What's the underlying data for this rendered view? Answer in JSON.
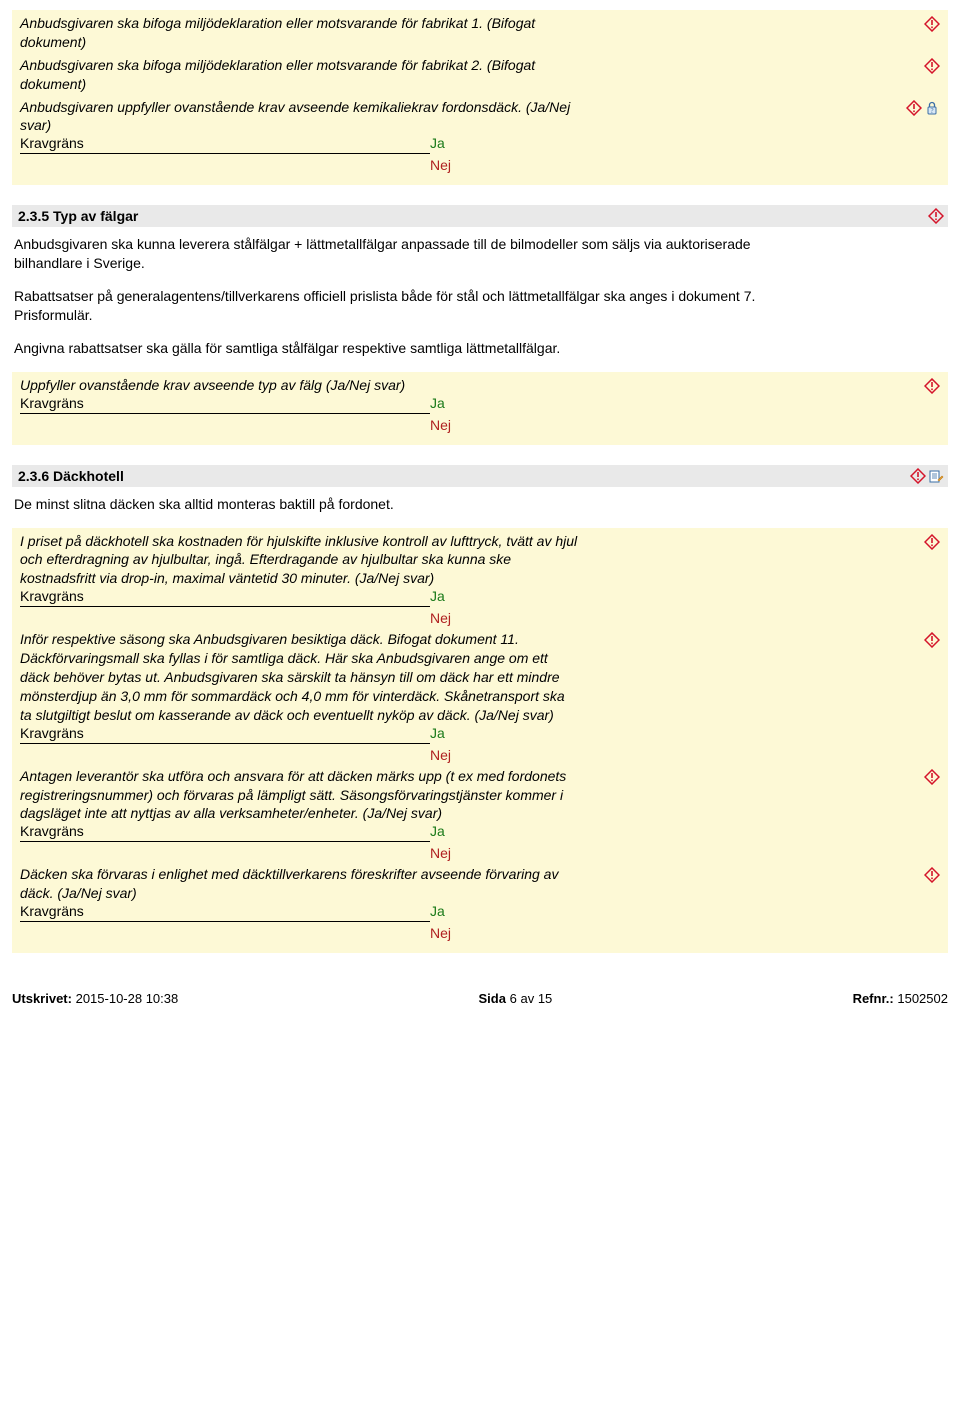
{
  "common": {
    "kravgrans": "Kravgräns",
    "ja": "Ja",
    "nej": "Nej"
  },
  "top_box": {
    "items": [
      {
        "text": "Anbudsgivaren ska bifoga miljödeklaration eller motsvarande för fabrikat 1. (Bifogat dokument)",
        "icons": [
          "warn"
        ]
      },
      {
        "text": "Anbudsgivaren ska bifoga miljödeklaration eller motsvarande för fabrikat 2. (Bifogat dokument)",
        "icons": [
          "warn"
        ]
      },
      {
        "text": "Anbudsgivaren uppfyller ovanstående krav avseende kemikaliekrav fordonsdäck. (Ja/Nej svar)",
        "icons": [
          "warn",
          "lock"
        ],
        "krav": true
      }
    ]
  },
  "sec235": {
    "title": "2.3.5 Typ av fälgar",
    "icons": [
      "warn"
    ],
    "body": [
      "Anbudsgivaren ska kunna leverera stålfälgar + lättmetallfälgar anpassade till de bilmodeller som säljs via auktoriserade bilhandlare i Sverige.",
      "Rabattsatser på generalagentens/tillverkarens officiell prislista både för stål och lättmetallfälgar ska anges i dokument 7. Prisformulär.",
      "Angivna rabattsatser ska gälla för samtliga stålfälgar respektive samtliga lättmetallfälgar."
    ],
    "box_items": [
      {
        "text": "Uppfyller ovanstående krav avseende typ av fälg (Ja/Nej svar)",
        "icons": [
          "warn"
        ],
        "krav": true
      }
    ]
  },
  "sec236": {
    "title": "2.3.6 Däckhotell",
    "icons": [
      "warn",
      "edit"
    ],
    "body": [
      "De minst slitna däcken ska alltid monteras baktill på fordonet."
    ],
    "box_items": [
      {
        "text": "I priset på däckhotell ska kostnaden för hjulskifte inklusive kontroll av lufttryck, tvätt av hjul och efterdragning av hjulbultar, ingå. Efterdragande av hjulbultar ska kunna ske kostnadsfritt via drop-in, maximal väntetid 30 minuter. (Ja/Nej svar)",
        "icons": [
          "warn"
        ],
        "krav": true
      },
      {
        "text": "Inför respektive säsong ska Anbudsgivaren besiktiga däck. Bifogat dokument 11. Däckförvaringsmall ska fyllas i för samtliga däck. Här ska Anbudsgivaren ange om ett däck behöver bytas ut. Anbudsgivaren ska särskilt ta hänsyn till om däck har ett mindre mönsterdjup än 3,0 mm för sommardäck och 4,0 mm för vinterdäck. Skånetransport ska ta slutgiltigt beslut om kasserande av däck och eventuellt nyköp av däck. (Ja/Nej svar)",
        "icons": [
          "warn"
        ],
        "krav": true
      },
      {
        "text": "Antagen leverantör ska utföra och ansvara för att däcken märks upp (t ex med fordonets registreringsnummer) och förvaras på lämpligt sätt. Säsongsförvaringstjänster kommer i dagsläget inte att nyttjas av alla verksamheter/enheter. (Ja/Nej svar)",
        "icons": [
          "warn"
        ],
        "krav": true
      },
      {
        "text": "Däcken ska förvaras i enlighet med däcktillverkarens föreskrifter avseende förvaring av däck. (Ja/Nej svar)",
        "icons": [
          "warn"
        ],
        "krav": true
      }
    ]
  },
  "footer": {
    "utskrivet_label": "Utskrivet:",
    "utskrivet_value": "2015-10-28 10:38",
    "sida_label": "Sida",
    "sida_num": "6",
    "av": "av",
    "sida_total": "15",
    "refnr_label": "Refnr.:",
    "refnr_value": "1502502"
  }
}
